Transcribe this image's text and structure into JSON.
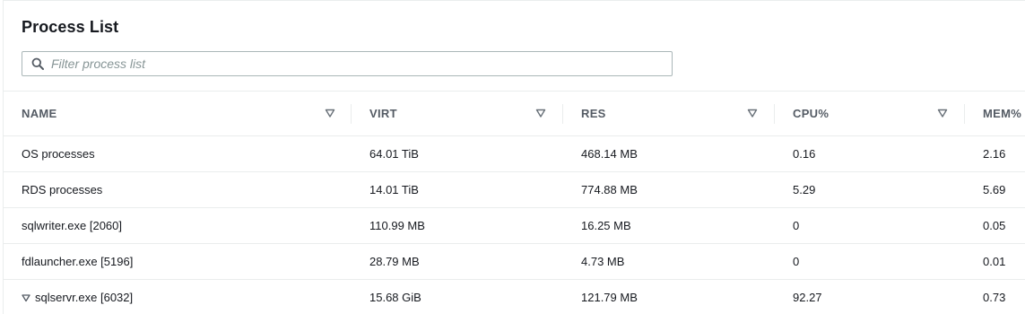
{
  "panel": {
    "title": "Process List",
    "search": {
      "placeholder": "Filter process list",
      "value": ""
    }
  },
  "table": {
    "columns": [
      {
        "key": "name",
        "label": "NAME"
      },
      {
        "key": "virt",
        "label": "VIRT"
      },
      {
        "key": "res",
        "label": "RES"
      },
      {
        "key": "cpu",
        "label": "CPU%"
      },
      {
        "key": "mem",
        "label": "MEM%"
      }
    ],
    "rows": [
      {
        "name": "OS processes",
        "virt": "64.01 TiB",
        "res": "468.14 MB",
        "cpu": "0.16",
        "mem": "2.16",
        "expandable": false
      },
      {
        "name": "RDS processes",
        "virt": "14.01 TiB",
        "res": "774.88 MB",
        "cpu": "5.29",
        "mem": "5.69",
        "expandable": false
      },
      {
        "name": "sqlwriter.exe [2060]",
        "virt": "110.99 MB",
        "res": "16.25 MB",
        "cpu": "0",
        "mem": "0.05",
        "expandable": false
      },
      {
        "name": "fdlauncher.exe [5196]",
        "virt": "28.79 MB",
        "res": "4.73 MB",
        "cpu": "0",
        "mem": "0.01",
        "expandable": false
      },
      {
        "name": "sqlservr.exe [6032]",
        "virt": "15.68 GiB",
        "res": "121.79 MB",
        "cpu": "92.27",
        "mem": "0.73",
        "expandable": true
      }
    ]
  },
  "icons": {
    "search": "search-icon",
    "sort": "sort-caret-icon",
    "expand": "expand-caret-icon"
  },
  "colors": {
    "header_text": "#545b64",
    "body_text": "#16191f",
    "border": "#eaeded",
    "input_border": "#aab7b8",
    "placeholder": "#879596"
  }
}
